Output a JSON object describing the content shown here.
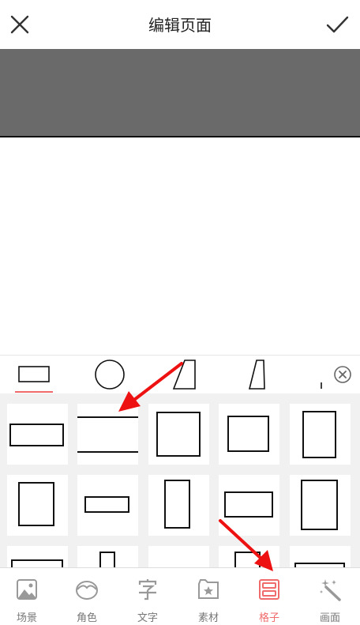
{
  "header": {
    "title": "编辑页面",
    "close_icon": "close-icon",
    "confirm_icon": "check-icon"
  },
  "shape_tabs": {
    "items": [
      {
        "name": "rectangle",
        "icon": "rectangle-shape-icon",
        "selected": true
      },
      {
        "name": "circle",
        "icon": "circle-shape-icon",
        "selected": false
      },
      {
        "name": "parallelogram",
        "icon": "parallelogram-shape-icon",
        "selected": false
      },
      {
        "name": "trapezoid",
        "icon": "trapezoid-shape-icon",
        "selected": false
      }
    ],
    "close_icon": "close-circle-icon",
    "accent": "#f06b6b"
  },
  "bottom_nav": {
    "items": [
      {
        "label": "场景",
        "icon": "image-icon",
        "active": false
      },
      {
        "label": "角色",
        "icon": "character-icon",
        "active": false
      },
      {
        "label": "文字",
        "icon": "text-icon",
        "active": false
      },
      {
        "label": "素材",
        "icon": "sticker-folder-icon",
        "active": false
      },
      {
        "label": "格子",
        "icon": "grid-layout-icon",
        "active": true
      },
      {
        "label": "画面",
        "icon": "magic-wand-icon",
        "active": false
      }
    ],
    "active_color": "#f06b6b",
    "inactive_color": "#777777"
  },
  "annotations": {
    "arrow_color": "#ee1111"
  }
}
